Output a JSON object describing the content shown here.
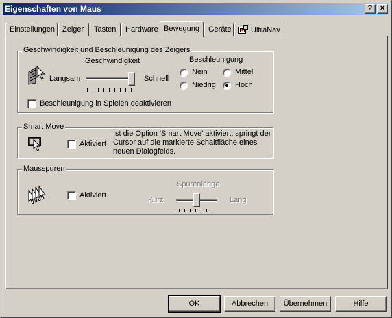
{
  "window": {
    "title": "Eigenschaften von Maus",
    "help_button": "?",
    "close_button": "×"
  },
  "tabs": [
    {
      "label": "Einstellungen"
    },
    {
      "label": "Zeiger"
    },
    {
      "label": "Tasten"
    },
    {
      "label": "Hardware"
    },
    {
      "label": "Bewegung",
      "active": true
    },
    {
      "label": "Geräte"
    },
    {
      "label": "UltraNav",
      "icon": "ultranav-icon"
    }
  ],
  "speed_group": {
    "title": "Geschwindigkeit und Beschleunigung des Zeigers",
    "speed_heading": "Geschwindigkeit",
    "slow": "Langsam",
    "fast": "Schnell",
    "speed_level": 1.0,
    "accel_heading": "Beschleunigung",
    "accel_options": [
      "Nein",
      "Mittel",
      "Niedrig",
      "Hoch"
    ],
    "accel_selected": "Hoch",
    "disable_games": "Beschleunigung in Spielen deaktivieren",
    "disable_games_checked": false
  },
  "smart_move": {
    "title": "Smart Move",
    "checkbox": "Aktiviert",
    "checked": false,
    "description_lines": [
      "Ist die Option 'Smart Move' aktiviert, springt der",
      "Cursor auf die markierte Schaltfläche eines",
      "neuen Dialogfelds."
    ]
  },
  "trails": {
    "title": "Mausspuren",
    "checkbox": "Aktiviert",
    "checked": false,
    "length_heading": "Spurenlänge",
    "short": "Kurz",
    "long": "Lang",
    "length_level": 0.5
  },
  "buttons": {
    "ok": "OK",
    "cancel": "Abbrechen",
    "apply": "Übernehmen",
    "help": "Hilfe"
  }
}
